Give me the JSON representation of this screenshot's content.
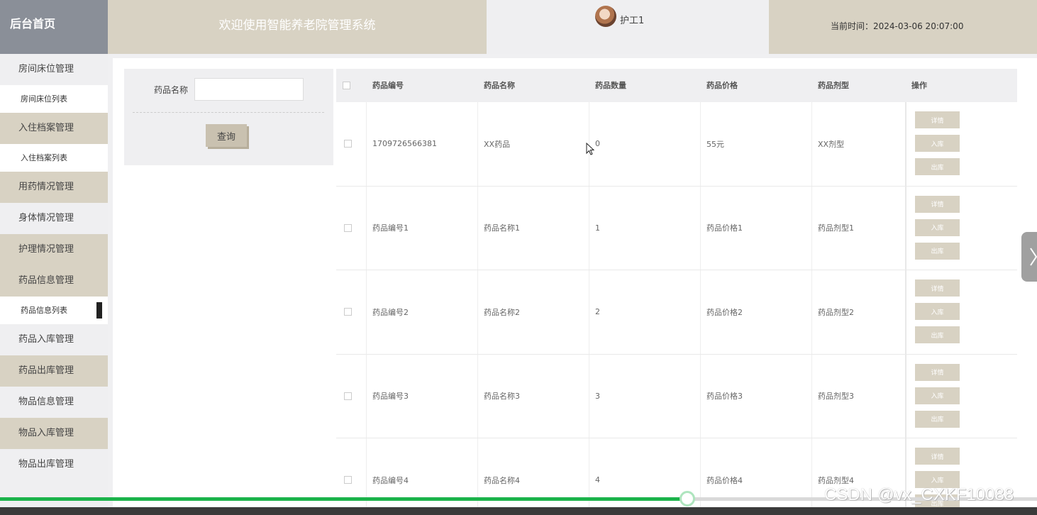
{
  "header": {
    "brand": "后台首页",
    "welcome": "欢迎使用智能养老院管理系统",
    "username": "护工1",
    "time_text": "当前时间：2024-03-06 20:07:00"
  },
  "sidebar": {
    "items": [
      {
        "label": "房间床位管理",
        "style": "gray"
      },
      {
        "label": "房间床位列表",
        "sub": true
      },
      {
        "label": "入住档案管理",
        "style": "beige"
      },
      {
        "label": "入住档案列表",
        "sub": true
      },
      {
        "label": "用药情况管理",
        "style": "beige"
      },
      {
        "label": "身体情况管理",
        "style": "gray"
      },
      {
        "label": "护理情况管理",
        "style": "beige"
      },
      {
        "label": "药品信息管理",
        "style": "beige"
      },
      {
        "label": "药品信息列表",
        "sub": true,
        "active": true
      },
      {
        "label": "药品入库管理",
        "style": "gray"
      },
      {
        "label": "药品出库管理",
        "style": "beige"
      },
      {
        "label": "物品信息管理",
        "style": "gray"
      },
      {
        "label": "物品入库管理",
        "style": "beige"
      },
      {
        "label": "物品出库管理",
        "style": "gray"
      }
    ]
  },
  "search": {
    "label": "药品名称",
    "value": "",
    "button": "查询"
  },
  "table": {
    "headers": [
      "药品编号",
      "药品名称",
      "药品数量",
      "药品价格",
      "药品剂型",
      "操作"
    ],
    "rows": [
      [
        "1709726566381",
        "XX药品",
        "0",
        "55元",
        "XX剂型"
      ],
      [
        "药品编号1",
        "药品名称1",
        "1",
        "药品价格1",
        "药品剂型1"
      ],
      [
        "药品编号2",
        "药品名称2",
        "2",
        "药品价格2",
        "药品剂型2"
      ],
      [
        "药品编号3",
        "药品名称3",
        "3",
        "药品价格3",
        "药品剂型3"
      ],
      [
        "药品编号4",
        "药品名称4",
        "4",
        "药品价格4",
        "药品剂型4"
      ]
    ],
    "actions": [
      "详情",
      "入库",
      "出库"
    ]
  },
  "video": {
    "progress_fraction": 0.663
  },
  "watermark": "CSDN @vx_CXKF10088",
  "colors": {
    "beige": "#d8d2c3",
    "gray": "#efeff1",
    "brand": "#8a8f98",
    "progress": "#1cb34b"
  }
}
